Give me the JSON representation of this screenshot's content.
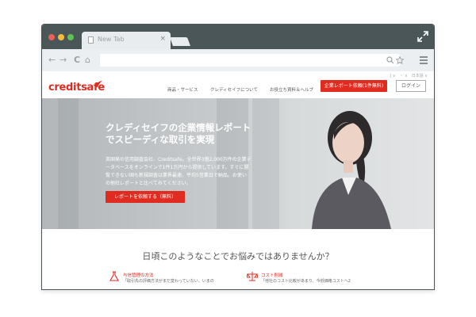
{
  "browser": {
    "tab_title": "New Tab",
    "tab_close": "×",
    "nav_back": "←",
    "nav_forward": "→",
    "nav_reload": "C",
    "nav_home": "⌂"
  },
  "site": {
    "logo_text": "creditsafe",
    "top_links": "J ∨　・ ∨　日本語 ∨",
    "nav_items": [
      "商品・サービス",
      "クレディセイフについて",
      "お役立ち資料＆ヘルプ"
    ],
    "report_button": "企業レポート依頼(1件無料)",
    "login_button": "ログイン",
    "hero": {
      "title_line1": "クレディセイフの企業情報レポート",
      "title_line2": "でスピーディな取引を実現",
      "desc_line1": "英国発の信用調査会社、Creditsafe。全世界3億2,000万件の企業デ",
      "desc_line2": "ータベースをオンラインで1件1万円から提供しています。すぐに閲",
      "desc_line3": "覧できない国も新規調査は業界最速、平均5営業日で納品。お使い",
      "desc_line4": "の他社レポートと比べてみてください。",
      "cta": "レポートを依頼する（無料）"
    },
    "concern": {
      "heading": "日頃このようなことでお悩みではありませんか？",
      "items": [
        {
          "title": "与信管理の方法",
          "text": "「取引先の評価方法がまだ変わっていない、いまの"
        },
        {
          "title": "コスト削減",
          "text": "「他社のコスト比較があまり、今低価格コストへ2"
        }
      ]
    }
  },
  "colors": {
    "brand_red": "#e02b20",
    "titlebar": "#4b5659",
    "toolbar": "#eceff1"
  }
}
